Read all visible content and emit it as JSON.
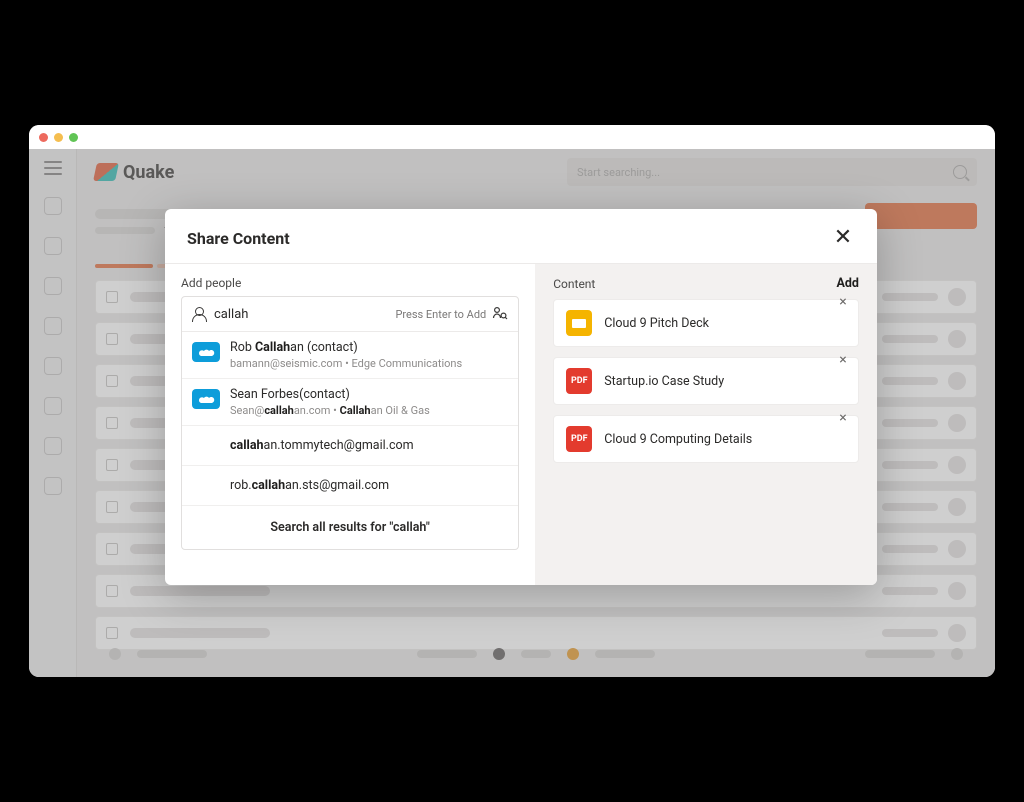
{
  "app": {
    "name": "Quake",
    "search_placeholder": "Start searching..."
  },
  "modal": {
    "title": "Share Content",
    "left": {
      "label": "Add people",
      "input_value": "callah",
      "input_hint": "Press Enter to Add",
      "search_all_prefix": "Search all results for ",
      "search_all_term": "\"callah\"",
      "options": [
        {
          "title_pre": "Rob ",
          "title_bold": "Callah",
          "title_post": "an (contact)",
          "sub_pre": "bamann@seismic.com • Edge Communications",
          "has_badge": true
        },
        {
          "title_pre": "Sean Forbes(contact)",
          "title_bold": "",
          "title_post": "",
          "sub_pre": "Sean@",
          "sub_bold1": "callah",
          "sub_mid": "an.com • ",
          "sub_bold2": "Callah",
          "sub_post": "an Oil & Gas",
          "has_badge": true
        },
        {
          "title_pre": "",
          "title_bold": "callah",
          "title_post": "an.tommytech@gmail.com",
          "has_badge": false
        },
        {
          "title_pre": "rob.",
          "title_bold": "callah",
          "title_post": "an.sts@gmail.com",
          "has_badge": false
        }
      ]
    },
    "right": {
      "label": "Content",
      "add_label": "Add",
      "items": [
        {
          "title": "Cloud 9 Pitch Deck",
          "type": "doc"
        },
        {
          "title": "Startup.io Case Study",
          "type": "pdf",
          "badge_text": "PDF"
        },
        {
          "title": "Cloud 9 Computing Details",
          "type": "pdf",
          "badge_text": "PDF"
        }
      ]
    }
  }
}
